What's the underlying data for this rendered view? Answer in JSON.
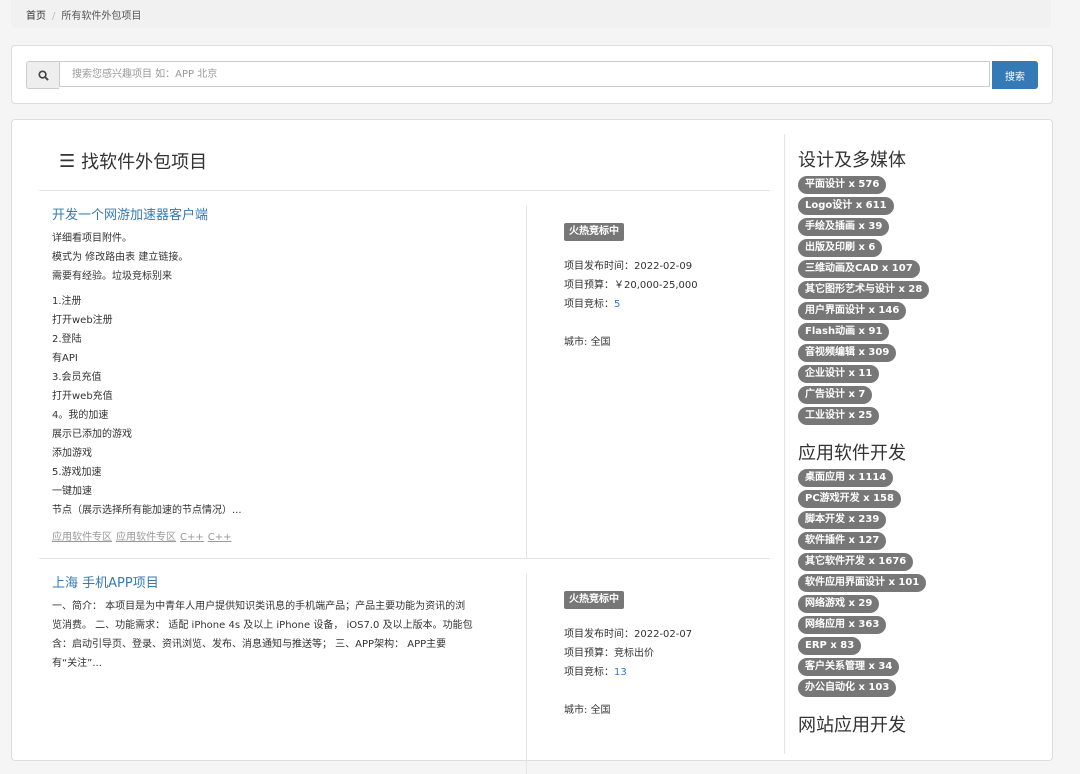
{
  "breadcrumb": {
    "home": "首页",
    "separator": "/",
    "current": "所有软件外包项目"
  },
  "search": {
    "placeholder": "搜索您感兴趣项目 如：APP 北京",
    "button": "搜索",
    "icon": "search-icon"
  },
  "main": {
    "title": "找软件外包项目",
    "projects": [
      {
        "title": "开发一个网游加速器客户端",
        "desc_lines": [
          "详细看项目附件。",
          "模式为 修改路由表 建立链接。",
          "需要有经验。垃圾竞标别来"
        ],
        "list_lines": [
          "1.注册",
          "打开web注册",
          "2.登陆",
          "有API",
          "3.会员充值",
          "打开web充值",
          "4。我的加速",
          "展示已添加的游戏",
          "添加游戏",
          "5.游戏加速",
          "一键加速",
          "节点（展示选择所有能加速的节点情况）..."
        ],
        "tags": [
          "应用软件专区",
          "应用软件专区",
          "C++",
          "C++"
        ],
        "badge": "火热竞标中",
        "publish_label": "项目发布时间：",
        "publish_date": "2022-02-09",
        "budget_label": "项目预算：",
        "budget": "￥20,000-25,000",
        "bids_label": "项目竞标：",
        "bids": "5",
        "city_label": "城市:",
        "city": "全国"
      },
      {
        "title": "上海 手机APP项目",
        "desc_lines": [
          "一、简介： 本项目是为中青年人用户提供知识类讯息的手机端产品；产品主要功能为资讯的浏",
          "览消费。 二、功能需求： 适配 iPhone 4s 及以上 iPhone 设备， iOS7.0 及以上版本。功能包",
          "含：启动引导页、登录、资讯浏览、发布、消息通知与推送等； 三、APP架构： APP主要",
          "有“关注”..."
        ],
        "badge": "火热竞标中",
        "publish_label": "项目发布时间：",
        "publish_date": "2022-02-07",
        "budget_label": "项目预算：",
        "budget": "竞标出价",
        "bids_label": "项目竞标：",
        "bids": "13",
        "city_label": "城市:",
        "city": "全国"
      }
    ]
  },
  "sidebar": {
    "categories": [
      {
        "title": "设计及多媒体",
        "items": [
          "平面设计 x 576",
          "Logo设计 x 611",
          "手绘及插画 x 39",
          "出版及印刷 x 6",
          "三维动画及CAD x 107",
          "其它图形艺术与设计 x 28",
          "用户界面设计 x 146",
          "Flash动画 x 91",
          "音视频编辑 x 309",
          "企业设计 x 11",
          "广告设计 x 7",
          "工业设计 x 25"
        ]
      },
      {
        "title": "应用软件开发",
        "items": [
          "桌面应用 x 1114",
          "PC游戏开发 x 158",
          "脚本开发 x 239",
          "软件插件 x 127",
          "其它软件开发 x 1676",
          "软件应用界面设计 x 101",
          "网络游戏 x 29",
          "网络应用 x 363",
          "ERP x 83",
          "客户关系管理 x 34",
          "办公自动化 x 103"
        ]
      },
      {
        "title": "网站应用开发",
        "items": []
      }
    ]
  }
}
